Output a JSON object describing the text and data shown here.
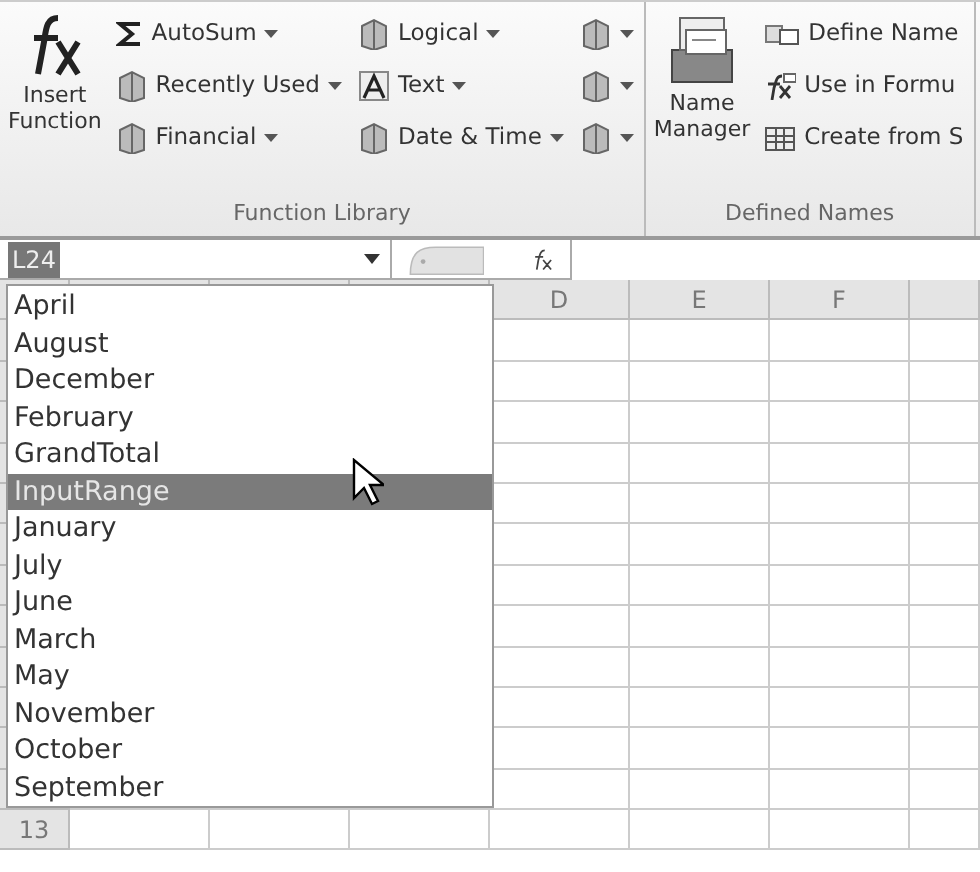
{
  "ribbon": {
    "groups": [
      {
        "label": "Function Library",
        "large_button": {
          "label_lines": [
            "Insert",
            "Function"
          ]
        },
        "columns": [
          [
            {
              "kind": "labeled",
              "label": "AutoSum",
              "has_menu": true
            },
            {
              "kind": "labeled",
              "label": "Recently Used",
              "has_menu": true
            },
            {
              "kind": "labeled",
              "label": "Financial",
              "has_menu": true
            }
          ],
          [
            {
              "kind": "labeled",
              "label": "Logical",
              "has_menu": true
            },
            {
              "kind": "labeled",
              "label": "Text",
              "has_menu": true
            },
            {
              "kind": "labeled",
              "label": "Date & Time",
              "has_menu": true
            }
          ],
          [
            {
              "kind": "iconic",
              "has_menu": true
            },
            {
              "kind": "iconic",
              "has_menu": true
            },
            {
              "kind": "iconic",
              "has_menu": true
            }
          ]
        ]
      },
      {
        "label": "Defined Names",
        "large_button": {
          "label_lines": [
            "Name",
            "Manager"
          ]
        },
        "columns": [
          [
            {
              "kind": "labeled",
              "label": "Define Name",
              "has_menu": false
            },
            {
              "kind": "labeled",
              "label": "Use in Formu",
              "has_menu": false
            },
            {
              "kind": "labeled",
              "label": "Create from S",
              "has_menu": false
            }
          ]
        ]
      }
    ]
  },
  "formula_bar": {
    "name_box": "L24"
  },
  "name_list": [
    {
      "label": "April",
      "selected": false
    },
    {
      "label": "August",
      "selected": false
    },
    {
      "label": "December",
      "selected": false
    },
    {
      "label": "February",
      "selected": false
    },
    {
      "label": "GrandTotal",
      "selected": false
    },
    {
      "label": "InputRange",
      "selected": true
    },
    {
      "label": "January",
      "selected": false
    },
    {
      "label": "July",
      "selected": false
    },
    {
      "label": "June",
      "selected": false
    },
    {
      "label": "March",
      "selected": false
    },
    {
      "label": "May",
      "selected": false
    },
    {
      "label": "November",
      "selected": false
    },
    {
      "label": "October",
      "selected": false
    },
    {
      "label": "September",
      "selected": false
    }
  ],
  "sheet": {
    "column_headers": [
      "D",
      "E",
      "F"
    ],
    "row_headers": [
      "13"
    ]
  }
}
